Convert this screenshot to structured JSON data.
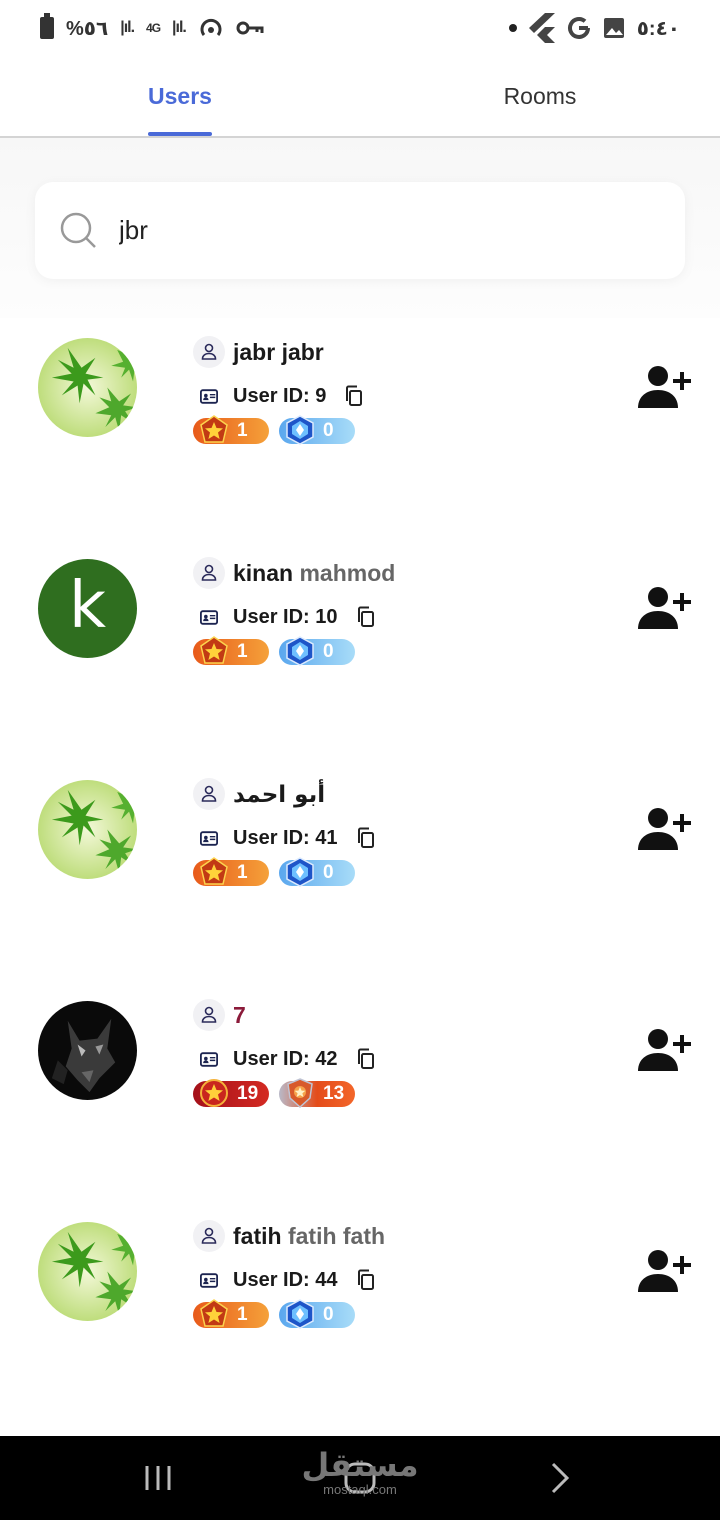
{
  "status_bar": {
    "battery_text": "%٥٦",
    "network": "4G",
    "time": "٥:٤٠"
  },
  "tabs": [
    {
      "label": "Users",
      "active": true
    },
    {
      "label": "Rooms",
      "active": false
    }
  ],
  "search": {
    "value": "jbr",
    "icon": "search-icon"
  },
  "users": [
    {
      "first": "jabr",
      "last": "jabr",
      "id_text": "User ID: 9",
      "avatar": "leaf-avatar",
      "badge1": "1",
      "badge2": "0"
    },
    {
      "first": "kinan",
      "last": "mahmod",
      "id_text": "User ID: 10",
      "avatar": "letter-avatar",
      "avatar_letter": "k",
      "badge1": "1",
      "badge2": "0"
    },
    {
      "first": "أبو احمد",
      "last": "",
      "id_text": "User ID: 41",
      "avatar": "leaf-avatar",
      "badge1": "1",
      "badge2": "0"
    },
    {
      "first": "7",
      "last": "",
      "id_text": "User ID: 42",
      "avatar": "wolf-avatar",
      "badge1": "19",
      "badge2": "13"
    },
    {
      "first": "fatih",
      "last": "fatih fath",
      "id_text": "User ID: 44",
      "avatar": "leaf-avatar",
      "badge1": "1",
      "badge2": "0"
    }
  ],
  "colors": {
    "accent": "#4a6ad8",
    "name_highlight": "#8b1a3a",
    "letter_avatar_bg": "#2f6e1f"
  },
  "watermark": {
    "line1": "مستقل",
    "line2": "mostaql.com"
  }
}
